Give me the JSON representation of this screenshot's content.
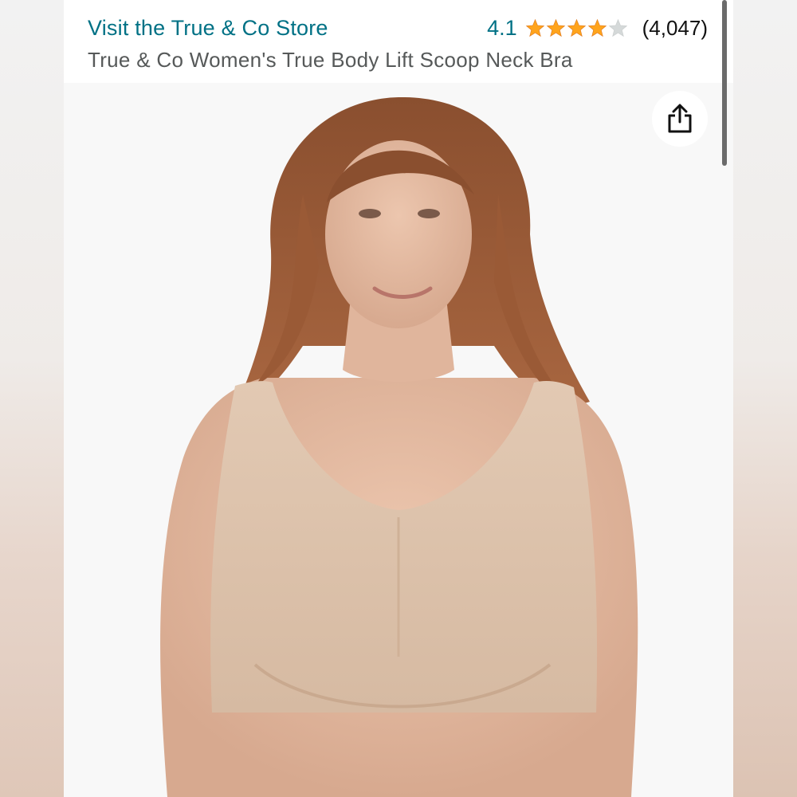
{
  "header": {
    "store_link": "Visit the True & Co Store",
    "rating_value": "4.1",
    "rating": 4.1,
    "rating_max": 5,
    "review_count": "(4,047)",
    "product_title": "True & Co Women's True Body Lift Scoop Neck Bra"
  },
  "image": {
    "share_icon": "share-icon"
  },
  "colors": {
    "link": "#007185",
    "star_fill": "#ffa41c",
    "star_empty": "#d5d9d9",
    "title": "#565959"
  }
}
